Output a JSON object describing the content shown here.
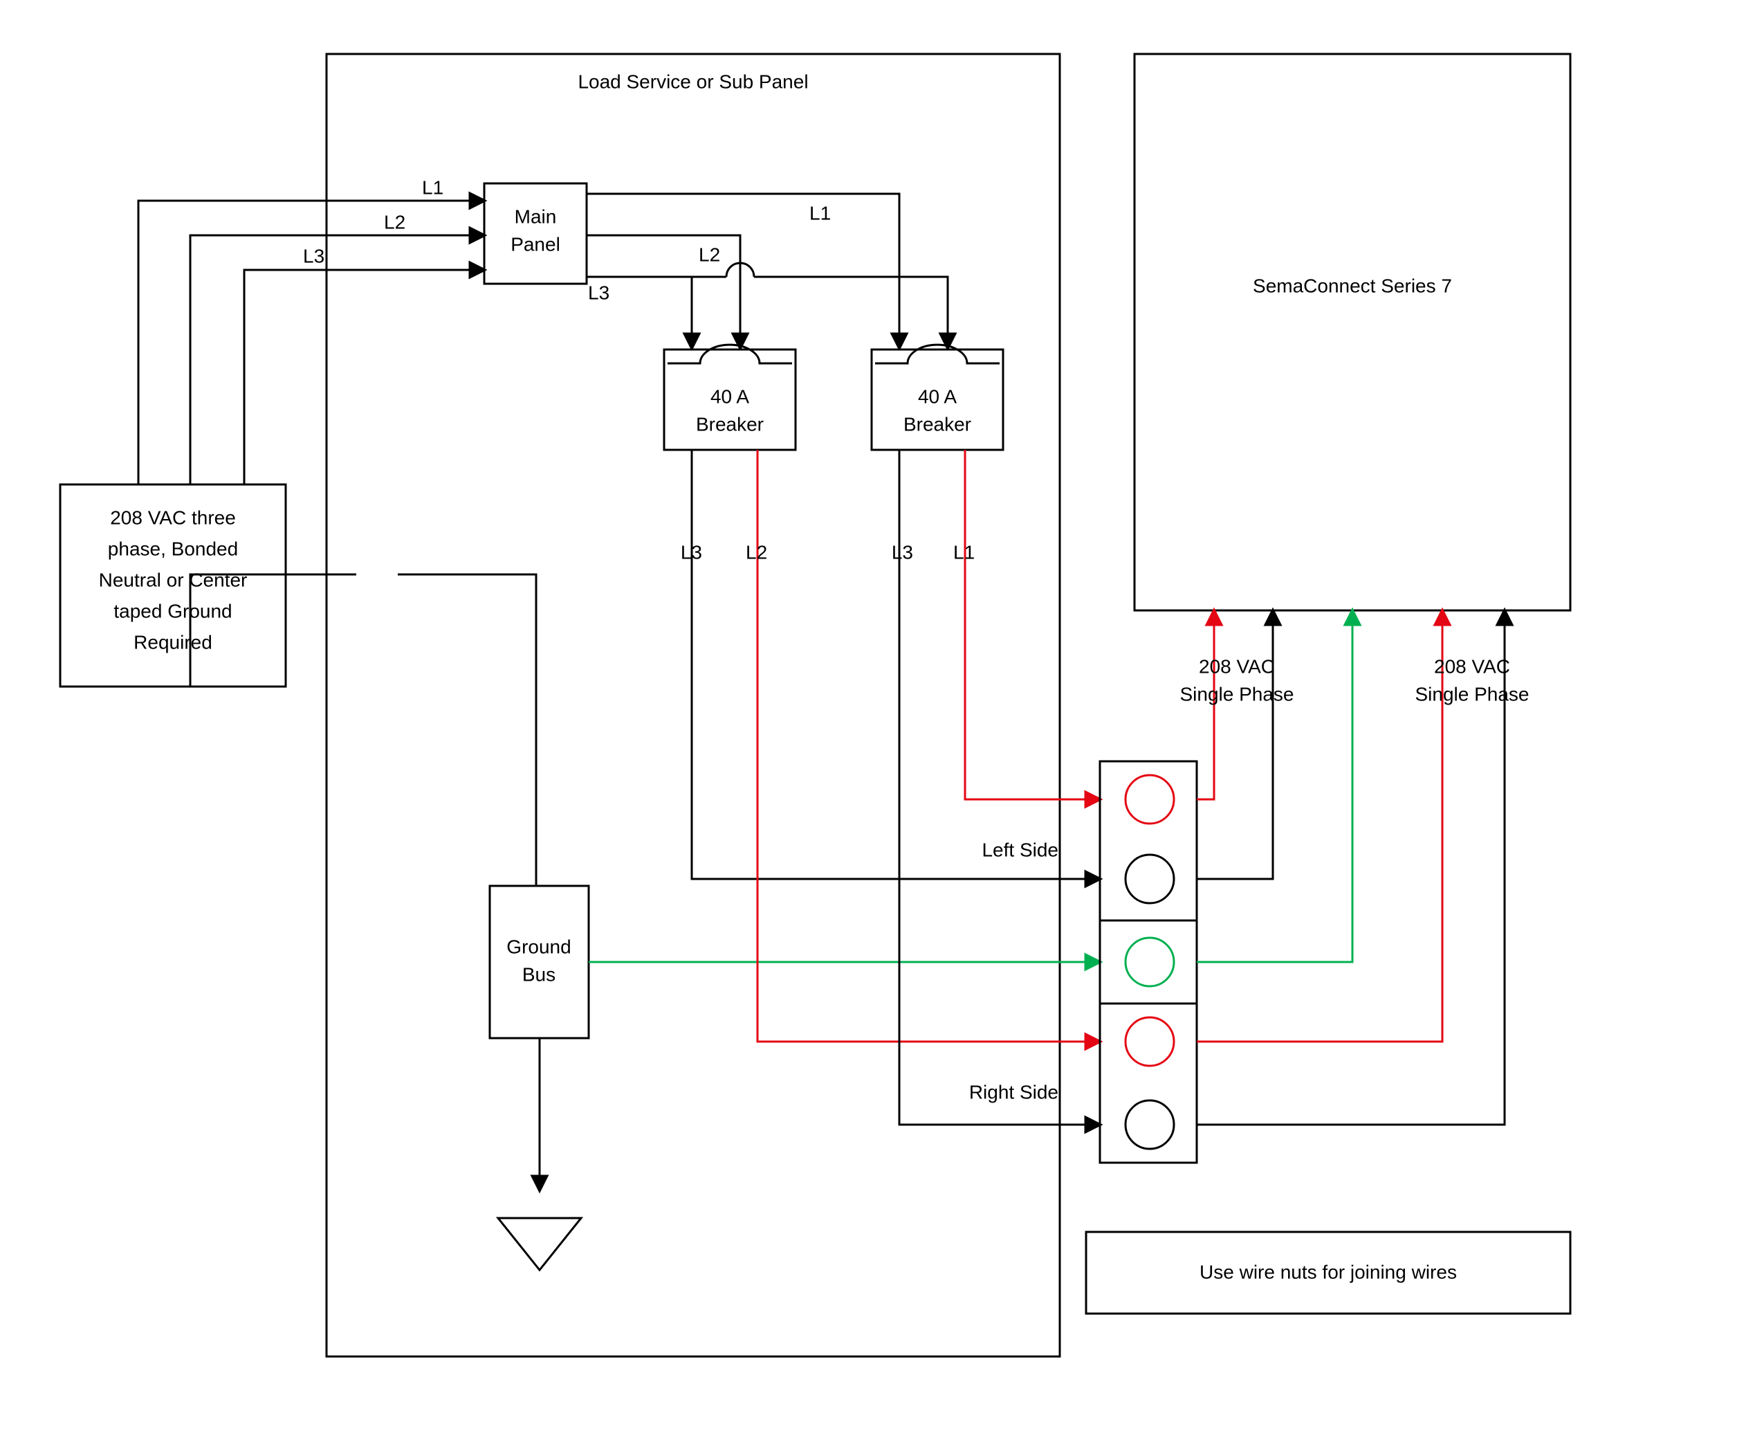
{
  "power": {
    "line1": "208 VAC three",
    "line2": "phase, Bonded",
    "line3": "Neutral or Center",
    "line4": "taped Ground",
    "line5": "Required"
  },
  "panel": {
    "title": "Load Service or Sub Panel",
    "main1": "Main",
    "main2": "Panel",
    "L1": "L1",
    "L2": "L2",
    "L3": "L3",
    "breaker1a": "40 A",
    "breaker1b": "Breaker",
    "breaker2a": "40 A",
    "breaker2b": "Breaker",
    "gbus1": "Ground",
    "gbus2": "Bus",
    "outL3a": "L3",
    "outL2a": "L2",
    "outL3b": "L3",
    "outL1b": "L1",
    "left": "Left Side",
    "right": "Right Side"
  },
  "device": {
    "name": "SemaConnect Series 7",
    "v1a": "208 VAC",
    "v1b": "Single Phase",
    "v2a": "208 VAC",
    "v2b": "Single Phase",
    "hint": "Use wire nuts for joining wires"
  }
}
